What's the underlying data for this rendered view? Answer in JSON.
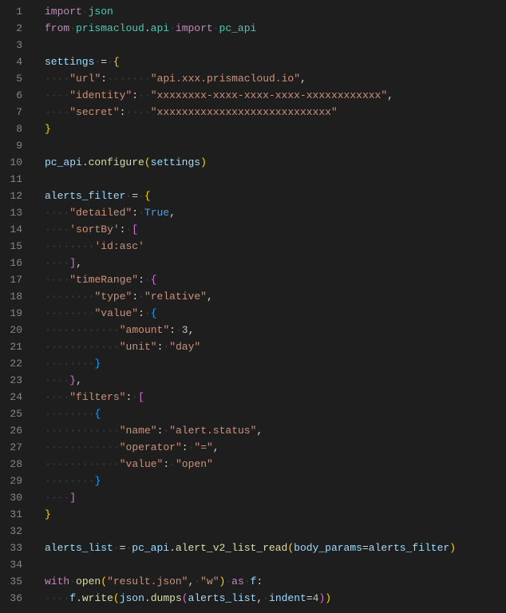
{
  "lineCount": 36,
  "tokens": {
    "l1": [
      [
        "kw",
        "import"
      ],
      [
        "ws",
        1
      ],
      [
        "mod",
        "json"
      ]
    ],
    "l2": [
      [
        "kw",
        "from"
      ],
      [
        "ws",
        1
      ],
      [
        "mod",
        "prismacloud"
      ],
      [
        "op",
        "."
      ],
      [
        "mod",
        "api"
      ],
      [
        "ws",
        1
      ],
      [
        "kw",
        "import"
      ],
      [
        "ws",
        1
      ],
      [
        "mod",
        "pc_api"
      ]
    ],
    "l3": [],
    "l4": [
      [
        "var",
        "settings"
      ],
      [
        "ws",
        1
      ],
      [
        "op",
        "="
      ],
      [
        "ws",
        1
      ],
      [
        "brace1",
        "{"
      ]
    ],
    "l5": [
      [
        "ws",
        4
      ],
      [
        "str",
        "\"url\""
      ],
      [
        "op",
        ":"
      ],
      [
        "ws",
        7
      ],
      [
        "str",
        "\"api.xxx.prismacloud.io\""
      ],
      [
        "op",
        ","
      ]
    ],
    "l6": [
      [
        "ws",
        4
      ],
      [
        "str",
        "\"identity\""
      ],
      [
        "op",
        ":"
      ],
      [
        "ws",
        2
      ],
      [
        "str",
        "\"xxxxxxxx-xxxx-xxxx-xxxx-xxxxxxxxxxxx\""
      ],
      [
        "op",
        ","
      ]
    ],
    "l7": [
      [
        "ws",
        4
      ],
      [
        "str",
        "\"secret\""
      ],
      [
        "op",
        ":"
      ],
      [
        "ws",
        4
      ],
      [
        "str",
        "\"xxxxxxxxxxxxxxxxxxxxxxxxxxxx\""
      ]
    ],
    "l8": [
      [
        "brace1",
        "}"
      ]
    ],
    "l9": [],
    "l10": [
      [
        "var",
        "pc_api"
      ],
      [
        "op",
        "."
      ],
      [
        "func",
        "configure"
      ],
      [
        "brace1",
        "("
      ],
      [
        "var",
        "settings"
      ],
      [
        "brace1",
        ")"
      ]
    ],
    "l11": [],
    "l12": [
      [
        "var",
        "alerts_filter"
      ],
      [
        "ws",
        1
      ],
      [
        "op",
        "="
      ],
      [
        "ws",
        1
      ],
      [
        "brace1",
        "{"
      ]
    ],
    "l13": [
      [
        "ws",
        4
      ],
      [
        "str",
        "\"detailed\""
      ],
      [
        "op",
        ":"
      ],
      [
        "ws",
        1
      ],
      [
        "const",
        "True"
      ],
      [
        "op",
        ","
      ]
    ],
    "l14": [
      [
        "ws",
        4
      ],
      [
        "str",
        "'sortBy'"
      ],
      [
        "op",
        ":"
      ],
      [
        "ws",
        1
      ],
      [
        "brace2",
        "["
      ]
    ],
    "l15": [
      [
        "ws",
        8
      ],
      [
        "str",
        "'id:asc'"
      ]
    ],
    "l16": [
      [
        "ws",
        4
      ],
      [
        "brace2",
        "]"
      ],
      [
        "op",
        ","
      ]
    ],
    "l17": [
      [
        "ws",
        4
      ],
      [
        "str",
        "\"timeRange\""
      ],
      [
        "op",
        ":"
      ],
      [
        "ws",
        1
      ],
      [
        "brace2",
        "{"
      ]
    ],
    "l18": [
      [
        "ws",
        8
      ],
      [
        "str",
        "\"type\""
      ],
      [
        "op",
        ":"
      ],
      [
        "ws",
        1
      ],
      [
        "str",
        "\"relative\""
      ],
      [
        "op",
        ","
      ]
    ],
    "l19": [
      [
        "ws",
        8
      ],
      [
        "str",
        "\"value\""
      ],
      [
        "op",
        ":"
      ],
      [
        "ws",
        1
      ],
      [
        "brace3",
        "{"
      ]
    ],
    "l20": [
      [
        "ws",
        12
      ],
      [
        "str",
        "\"amount\""
      ],
      [
        "op",
        ":"
      ],
      [
        "ws",
        1
      ],
      [
        "num",
        "3"
      ],
      [
        "op",
        ","
      ]
    ],
    "l21": [
      [
        "ws",
        12
      ],
      [
        "str",
        "\"unit\""
      ],
      [
        "op",
        ":"
      ],
      [
        "ws",
        1
      ],
      [
        "str",
        "\"day\""
      ]
    ],
    "l22": [
      [
        "ws",
        8
      ],
      [
        "brace3",
        "}"
      ]
    ],
    "l23": [
      [
        "ws",
        4
      ],
      [
        "brace2",
        "}"
      ],
      [
        "op",
        ","
      ]
    ],
    "l24": [
      [
        "ws",
        4
      ],
      [
        "str",
        "\"filters\""
      ],
      [
        "op",
        ":"
      ],
      [
        "ws",
        1
      ],
      [
        "brace2",
        "["
      ]
    ],
    "l25": [
      [
        "ws",
        8
      ],
      [
        "brace3",
        "{"
      ]
    ],
    "l26": [
      [
        "ws",
        12
      ],
      [
        "str",
        "\"name\""
      ],
      [
        "op",
        ":"
      ],
      [
        "ws",
        1
      ],
      [
        "str",
        "\"alert.status\""
      ],
      [
        "op",
        ","
      ]
    ],
    "l27": [
      [
        "ws",
        12
      ],
      [
        "str",
        "\"operator\""
      ],
      [
        "op",
        ":"
      ],
      [
        "ws",
        1
      ],
      [
        "str",
        "\"=\""
      ],
      [
        "op",
        ","
      ]
    ],
    "l28": [
      [
        "ws",
        12
      ],
      [
        "str",
        "\"value\""
      ],
      [
        "op",
        ":"
      ],
      [
        "ws",
        1
      ],
      [
        "str",
        "\"open\""
      ]
    ],
    "l29": [
      [
        "ws",
        8
      ],
      [
        "brace3",
        "}"
      ]
    ],
    "l30": [
      [
        "ws",
        4
      ],
      [
        "brace2",
        "]"
      ]
    ],
    "l31": [
      [
        "brace1",
        "}"
      ]
    ],
    "l32": [],
    "l33": [
      [
        "var",
        "alerts_list"
      ],
      [
        "ws",
        1
      ],
      [
        "op",
        "="
      ],
      [
        "ws",
        1
      ],
      [
        "var",
        "pc_api"
      ],
      [
        "op",
        "."
      ],
      [
        "func",
        "alert_v2_list_read"
      ],
      [
        "brace1",
        "("
      ],
      [
        "param",
        "body_params"
      ],
      [
        "op",
        "="
      ],
      [
        "var",
        "alerts_filter"
      ],
      [
        "brace1",
        ")"
      ]
    ],
    "l34": [],
    "l35": [
      [
        "kw",
        "with"
      ],
      [
        "ws",
        1
      ],
      [
        "func",
        "open"
      ],
      [
        "brace1",
        "("
      ],
      [
        "str",
        "\"result.json\""
      ],
      [
        "op",
        ","
      ],
      [
        "ws",
        1
      ],
      [
        "str",
        "\"w\""
      ],
      [
        "brace1",
        ")"
      ],
      [
        "ws",
        1
      ],
      [
        "kw",
        "as"
      ],
      [
        "ws",
        1
      ],
      [
        "var",
        "f"
      ],
      [
        "op",
        ":"
      ]
    ],
    "l36": [
      [
        "ws",
        4
      ],
      [
        "var",
        "f"
      ],
      [
        "op",
        "."
      ],
      [
        "func",
        "write"
      ],
      [
        "brace1",
        "("
      ],
      [
        "var",
        "json"
      ],
      [
        "op",
        "."
      ],
      [
        "func",
        "dumps"
      ],
      [
        "brace2",
        "("
      ],
      [
        "var",
        "alerts_list"
      ],
      [
        "op",
        ","
      ],
      [
        "ws",
        1
      ],
      [
        "param",
        "indent"
      ],
      [
        "op",
        "="
      ],
      [
        "num",
        "4"
      ],
      [
        "brace2",
        ")"
      ],
      [
        "brace1",
        ")"
      ]
    ]
  }
}
